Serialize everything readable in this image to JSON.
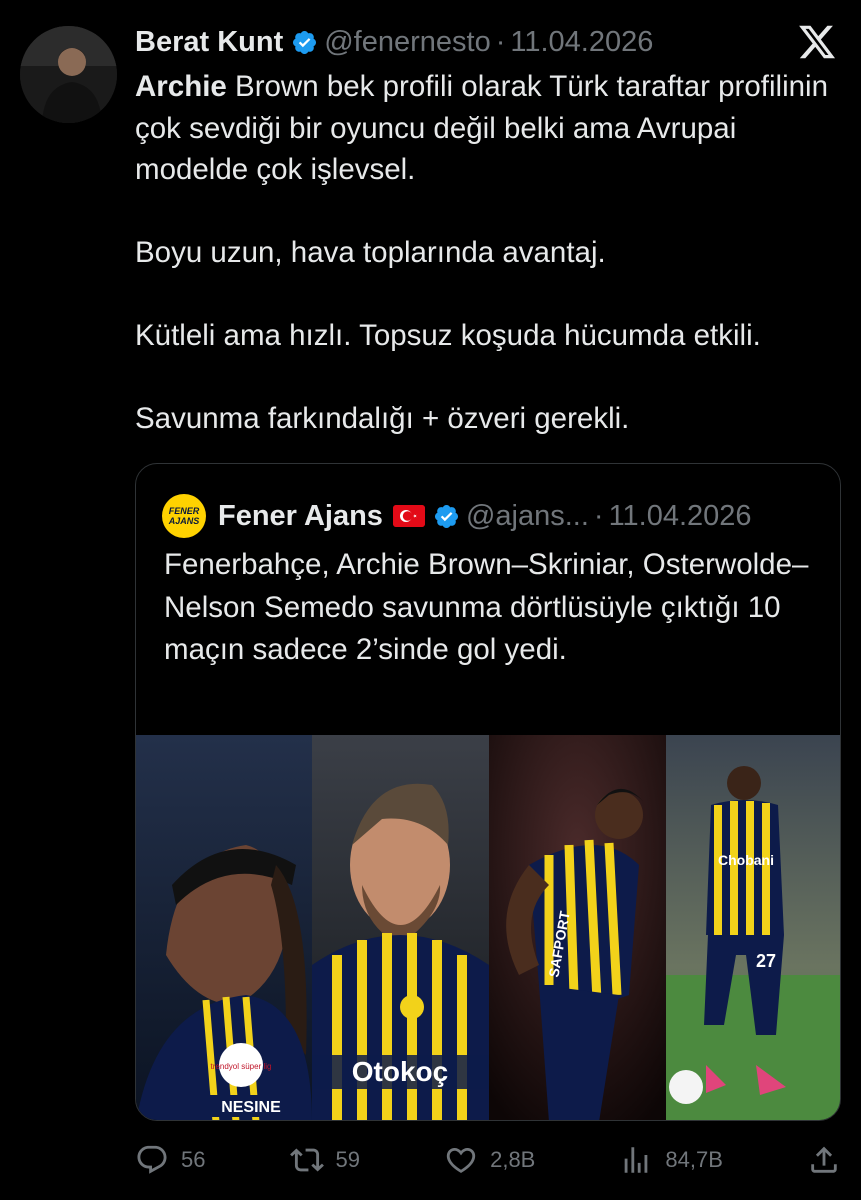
{
  "tweet": {
    "author_name": "Berat Kunt",
    "handle": "@fenernesto",
    "separator": "·",
    "date": "11.04.2026",
    "text_bold": "Archie",
    "text_line1_rest": " Brown bek profili olarak Türk taraftar profilinin çok sevdiği bir oyuncu değil belki ama Avrupai modelde çok işlevsel.",
    "paragraph2": "Boyu uzun, hava toplarında avantaj.",
    "paragraph3": "Kütleli ama hızlı. Topsuz koşuda hücumda etkili.",
    "paragraph4": "Savunma farkındalığı + özveri gerekli."
  },
  "quoted": {
    "author_name": "Fener Ajans",
    "handle": "@ajans...",
    "separator": "·",
    "date": "11.04.2026",
    "logo_text_top": "FENER",
    "logo_text_bottom": "AJANS",
    "text": "Fenerbahçe, Archie Brown–Skriniar, Osterwolde–Nelson Semedo savunma dörtlüsüyle çıktığı 10 maçın sadece 2’sinde gol yedi.",
    "media": {
      "panel1_sponsor": "NESINE",
      "panel1_badge": "trendyol süper lig",
      "panel2_sponsor": "Otokoç",
      "panel3_sponsor": "SAFPORT",
      "panel4_sponsor": "Chobani",
      "panel4_number": "27"
    }
  },
  "actions": {
    "replies": "56",
    "reposts": "59",
    "likes": "2,8B",
    "views": "84,7B"
  },
  "icons": {
    "verified": "verified-badge-icon",
    "x_logo": "x-logo-icon",
    "flag": "turkey-flag-icon",
    "reply": "reply-icon",
    "repost": "repost-icon",
    "like": "heart-icon",
    "views": "views-icon",
    "share": "share-icon"
  },
  "colors": {
    "background": "#000000",
    "text": "#e7e9ea",
    "muted": "#71767b",
    "verified": "#1d9bf0",
    "border": "#2f3336",
    "fener_yellow": "#ffd200",
    "fener_navy": "#0b1a3a"
  }
}
